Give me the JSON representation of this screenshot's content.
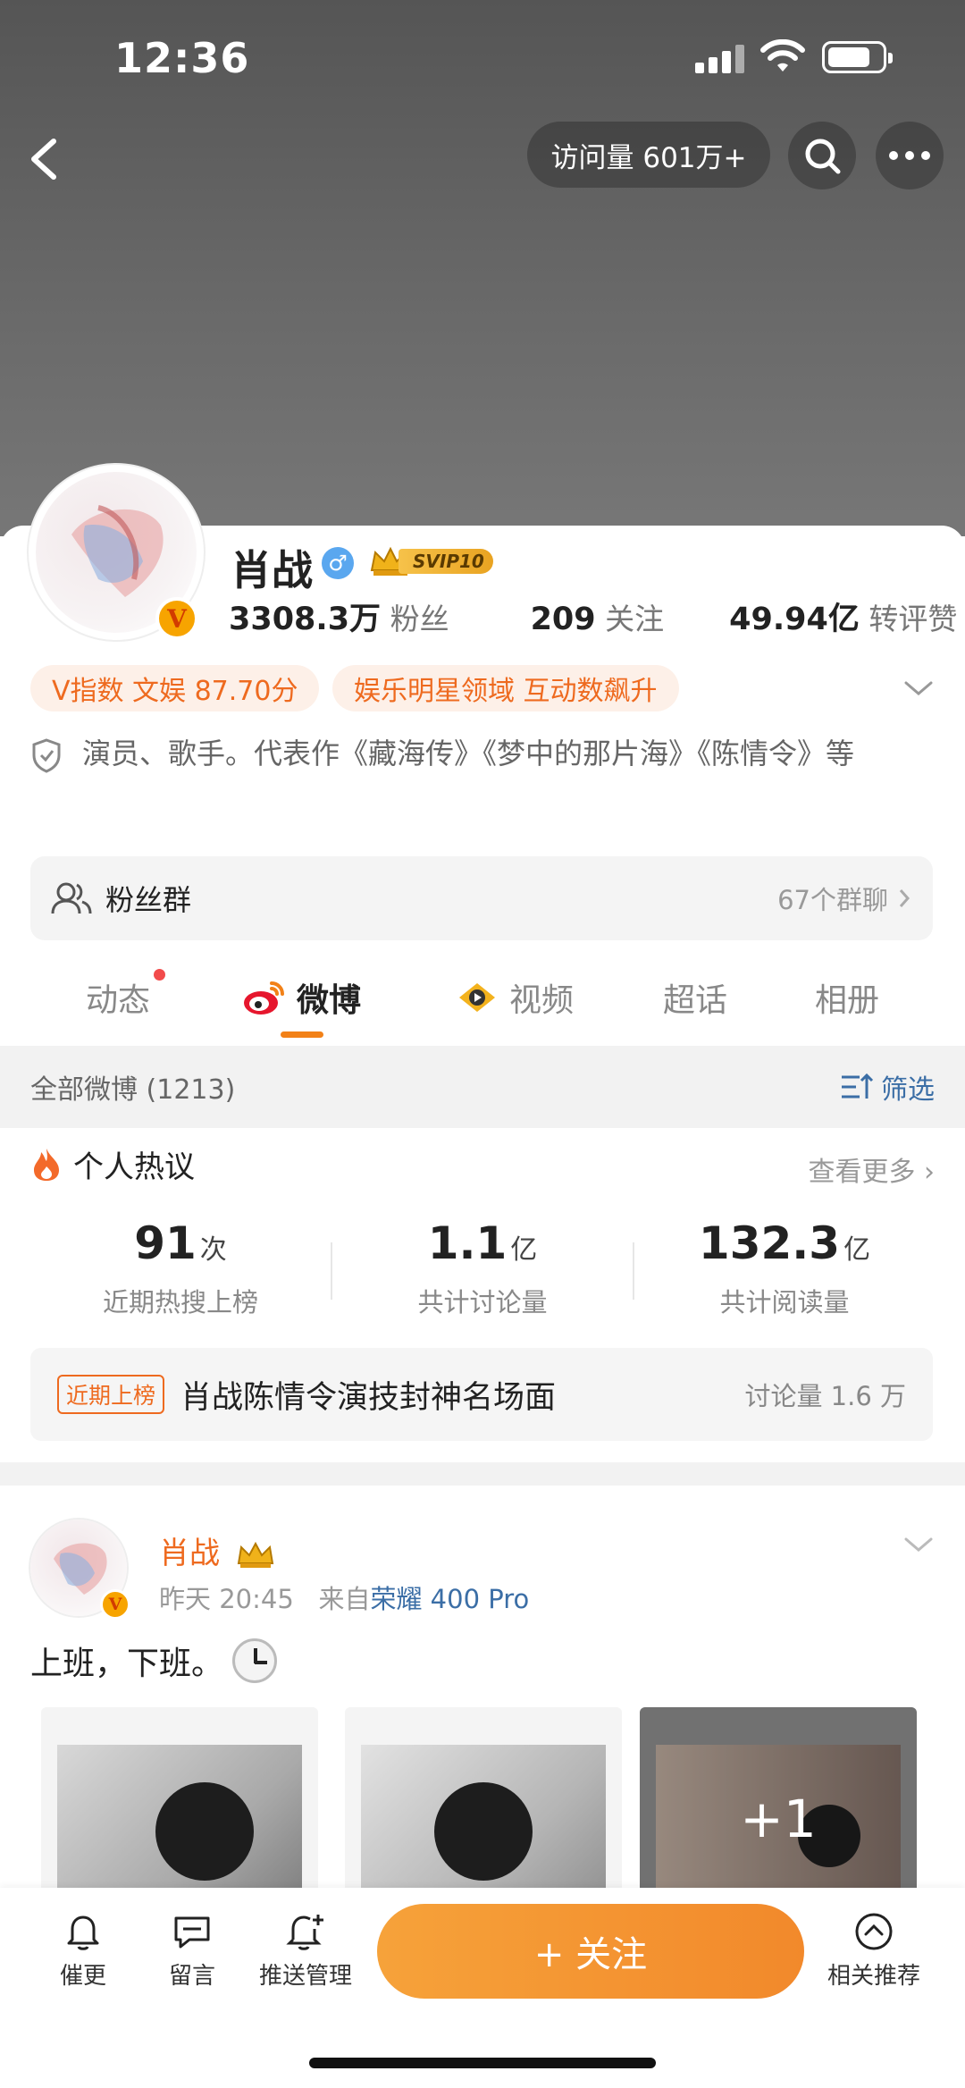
{
  "status_bar": {
    "time": "12:36"
  },
  "header": {
    "visit_count": "访问量 601万+"
  },
  "profile": {
    "name": "肖战",
    "gender_symbol": "♂",
    "svip_label": "SVIP10",
    "verified_badge": "V",
    "stats": [
      {
        "value": "3308.3万",
        "label": "粉丝"
      },
      {
        "value": "209",
        "label": "关注"
      },
      {
        "value": "49.94亿",
        "label": "转评赞"
      }
    ],
    "tags": [
      "V指数 文娱 87.70分",
      "娱乐明星领域 互动数飙升"
    ],
    "bio": "演员、歌手。代表作《藏海传》《梦中的那片海》《陈情令》等",
    "fan_group": {
      "label": "粉丝群",
      "count": "67个群聊"
    }
  },
  "tabs": [
    {
      "label": "动态"
    },
    {
      "label": "微博"
    },
    {
      "label": "视频"
    },
    {
      "label": "超话"
    },
    {
      "label": "相册"
    }
  ],
  "filter_bar": {
    "all_label": "全部微博 (1213)",
    "filter_label": "筛选"
  },
  "hot_discussion": {
    "title": "个人热议",
    "more_label": "查看更多",
    "metrics": [
      {
        "num": "91",
        "unit": "次",
        "desc": "近期热搜上榜"
      },
      {
        "num": "1.1",
        "unit": "亿",
        "desc": "共计讨论量"
      },
      {
        "num": "132.3",
        "unit": "亿",
        "desc": "共计阅读量"
      }
    ],
    "trending": {
      "badge": "近期上榜",
      "topic": "肖战陈情令演技封神名场面",
      "discussion": "讨论量 1.6 万"
    }
  },
  "post": {
    "author": "肖战",
    "time": "昨天 20:45",
    "source_prefix": "来自",
    "device": "荣耀 400 Pro",
    "text": "上班，下班。",
    "more_images": "+1"
  },
  "bottom_bar": {
    "items": [
      "催更",
      "留言",
      "推送管理"
    ],
    "follow_label": "+ 关注",
    "related_label": "相关推荐"
  }
}
